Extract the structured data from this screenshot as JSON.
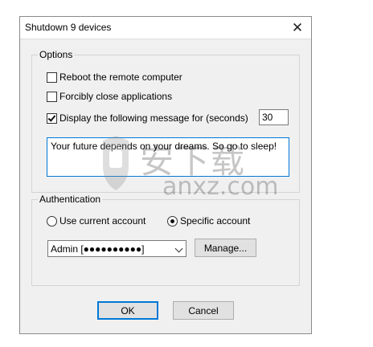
{
  "window": {
    "title": "Shutdown 9 devices"
  },
  "options": {
    "legend": "Options",
    "reboot": {
      "label": "Reboot the remote computer",
      "checked": false
    },
    "force_close": {
      "label": "Forcibly close applications",
      "checked": false
    },
    "display_message": {
      "label": "Display the following message for (seconds)",
      "checked": true
    },
    "seconds_value": "30",
    "message_text": "Your future depends on your dreams. So go to sleep!"
  },
  "authentication": {
    "legend": "Authentication",
    "current_label": "Use current account",
    "specific_label": "Specific account",
    "selected": "specific",
    "account_value": "Admin [●●●●●●●●●●]",
    "manage_label": "Manage..."
  },
  "buttons": {
    "ok": "OK",
    "cancel": "Cancel"
  },
  "watermark": {
    "cn_text": "安下载",
    "url_text": "anxz.com"
  },
  "icons": {
    "close": "close-icon",
    "dropdown": "chevron-down-icon",
    "watermark": "shield-logo-icon"
  }
}
